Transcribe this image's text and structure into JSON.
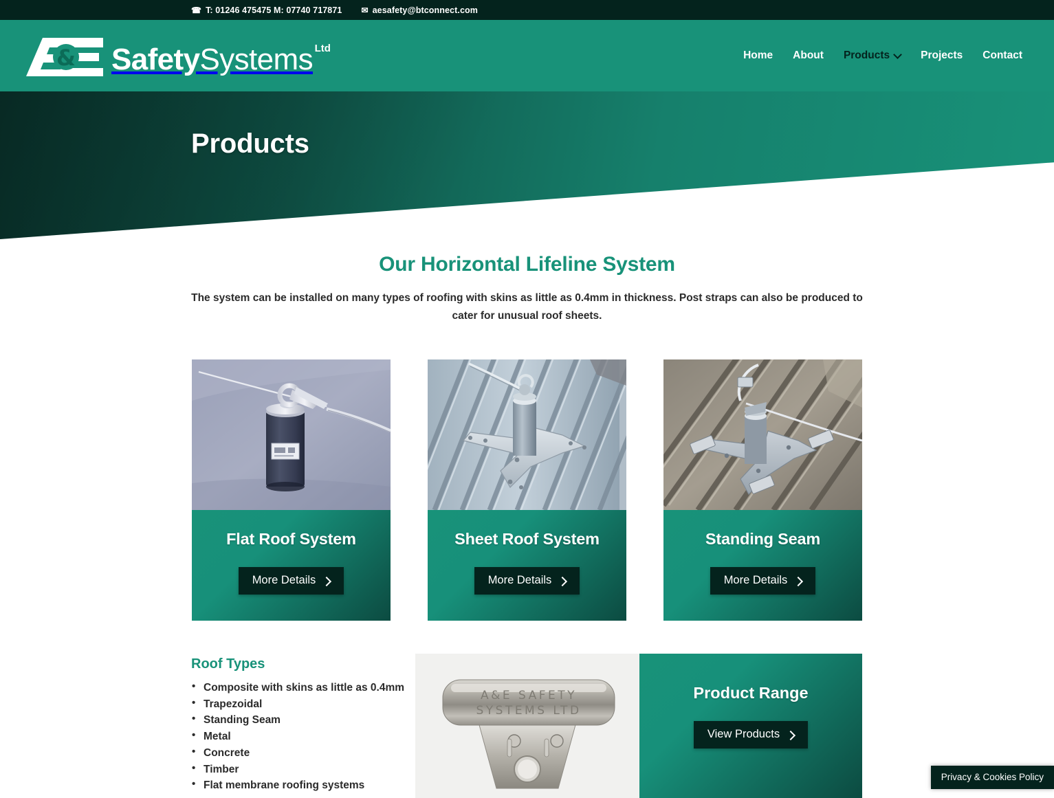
{
  "topbar": {
    "phone_icon": "phone-icon",
    "phone_text": "T: 01246 475475 M: 07740 717871",
    "mail_icon": "envelope-icon",
    "email_text": "aesafety@btconnect.com"
  },
  "logo": {
    "mark": "A&E",
    "word_bold": "Safety",
    "word_light": "Systems",
    "suffix": "Ltd"
  },
  "nav": {
    "items": [
      {
        "label": "Home",
        "active": false,
        "has_dropdown": false
      },
      {
        "label": "About",
        "active": false,
        "has_dropdown": false
      },
      {
        "label": "Products",
        "active": true,
        "has_dropdown": true
      },
      {
        "label": "Projects",
        "active": false,
        "has_dropdown": false
      },
      {
        "label": "Contact",
        "active": false,
        "has_dropdown": false
      }
    ]
  },
  "hero": {
    "title": "Products"
  },
  "section": {
    "title": "Our Horizontal Lifeline System",
    "description": "The system can be installed on many types of roofing with skins as little as 0.4mm in thickness. Post straps can also be produced to cater for unusual roof sheets."
  },
  "cards": [
    {
      "title": "Flat Roof System",
      "button": "More Details",
      "image": "flat-roof-post-photo"
    },
    {
      "title": "Sheet Roof System",
      "button": "More Details",
      "image": "sheet-roof-post-photo"
    },
    {
      "title": "Standing Seam",
      "button": "More Details",
      "image": "standing-seam-post-photo"
    }
  ],
  "roof_types": {
    "title": "Roof Types",
    "items": [
      "Composite with skins as little as 0.4mm",
      "Trapezoidal",
      "Standing Seam",
      "Metal",
      "Concrete",
      "Timber",
      "Flat membrane roofing systems"
    ]
  },
  "promo": {
    "image": "aande-safety-systems-bracket-photo",
    "engraving_line1": "A&E SAFETY",
    "engraving_line2": "SYSTEMS LTD",
    "title": "Product Range",
    "button": "View Products"
  },
  "cookie": {
    "label": "Privacy & Cookies Policy"
  },
  "colors": {
    "brand_teal": "#189279",
    "dark_green": "#04231d",
    "deep_green": "#0c4b41",
    "body_text": "#2b2b2b",
    "white": "#ffffff"
  }
}
